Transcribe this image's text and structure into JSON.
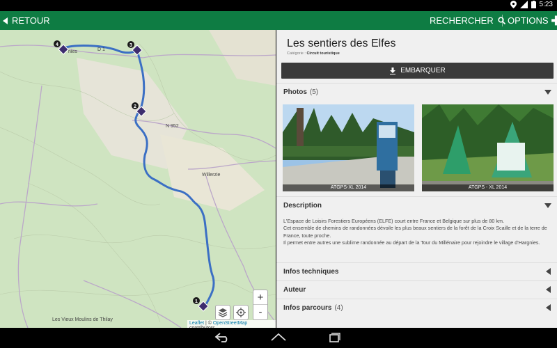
{
  "status": {
    "time": "5:23"
  },
  "actionbar": {
    "back_label": "RETOUR",
    "search_label": "RECHERCHER",
    "options_label": "OPTIONS"
  },
  "map": {
    "labels": {
      "place1": "Willerzie",
      "place2": "Les Vieux Moulins de Thilay",
      "road": "N 952",
      "road2": "D 1",
      "town_top": "nies"
    },
    "markers": [
      "1",
      "2",
      "3",
      "4"
    ],
    "zoom_in": "+",
    "zoom_out": "-",
    "attribution": {
      "leaflet": "Leaflet",
      "sep": " | © ",
      "osm": "OpenStreetMap",
      "contrib": " contributors"
    }
  },
  "detail": {
    "title": "Les sentiers des Elfes",
    "category_label": "Catégorie : ",
    "category_value": "Circuit touristique",
    "embark_label": "EMBARQUER",
    "photos": {
      "label": "Photos",
      "count": "(5)",
      "captions": [
        "ATGPS-XL 2014",
        "ATGPS - XL 2014"
      ]
    },
    "description": {
      "label": "Description",
      "lines": [
        "L'Espace de Loisirs Forestiers Européens (ELFE) court entre France et Belgique sur plus de 80 km.",
        "Cet ensemble de chemins de randonnées dévoile les plus beaux sentiers de la forêt de la Croix Scaille et de la terre de France, toute proche.",
        "Il permet entre autres une sublime randonnée au départ de la Tour du Millénaire pour rejoindre le village d'Hargnies."
      ]
    },
    "sections": [
      {
        "label": "Infos techniques",
        "count": ""
      },
      {
        "label": "Auteur",
        "count": ""
      },
      {
        "label": "Infos parcours",
        "count": "(4)"
      }
    ]
  },
  "colors": {
    "accent": "#0e7c43",
    "route": "#3b6fc4",
    "marker": "#3d2d6e"
  }
}
